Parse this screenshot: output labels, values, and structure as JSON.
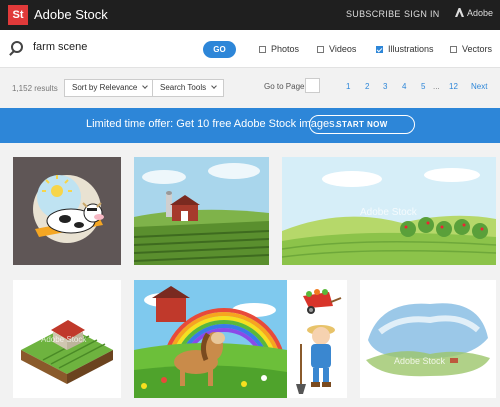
{
  "header": {
    "logo_mark": "St",
    "brand": "Adobe Stock",
    "subscribe": "SUBSCRIBE",
    "sign_in": "SIGN IN",
    "adobe": "Adobe"
  },
  "search": {
    "query": "farm scene",
    "go_label": "GO",
    "filters": [
      {
        "label": "Photos",
        "checked": false
      },
      {
        "label": "Videos",
        "checked": false
      },
      {
        "label": "Illustrations",
        "checked": true
      },
      {
        "label": "Vectors",
        "checked": false
      }
    ]
  },
  "toolbar": {
    "results_count": "1,152 results",
    "sort_label": "Sort by Relevance",
    "tools_label": "Search Tools",
    "go_to_page": "Go to Page",
    "pages": [
      "1",
      "2",
      "3",
      "4",
      "5"
    ],
    "ellipsis": "...",
    "last_page": "12",
    "next": "Next"
  },
  "promo": {
    "text": "Limited time offer: Get 10 free Adobe Stock images.",
    "button": "START NOW"
  },
  "gallery": {
    "watermark": "Adobe Stock",
    "images": [
      "cow-sunbathing-illustration",
      "farm-fields-barn-silo",
      "green-hills-orchard-landscape",
      "isometric-farm-plot",
      "cartoon-horse-rainbow-barn",
      "boy-farmer-wheelbarrow",
      "watercolor-countryside"
    ]
  },
  "colors": {
    "accent": "#2d86d8",
    "topbar": "#1f1f1f",
    "logo": "#e03a3a"
  }
}
